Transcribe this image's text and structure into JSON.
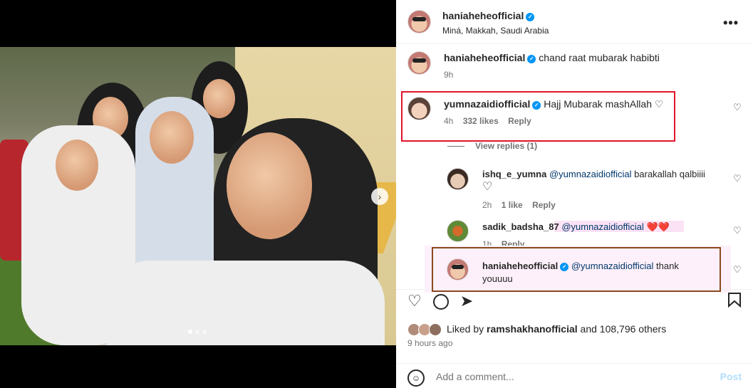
{
  "header": {
    "username": "haniaheheofficial",
    "location": "Miná, Makkah, Saudi Arabia",
    "more_icon": "more-horizontal-icon"
  },
  "caption": {
    "username": "haniaheheofficial",
    "text": "chand raat mubarak habibti",
    "time": "9h"
  },
  "comments": [
    {
      "username": "yumnazaidiofficial",
      "text": "Hajj Mubarak mashAllah ♡",
      "time": "4h",
      "likes": "332 likes",
      "reply": "Reply",
      "view_replies": "View replies (1)"
    }
  ],
  "replies": [
    {
      "username": "ishq_e_yumna",
      "mention": "@yumnazaidiofficial",
      "text": "barakallah qalbiiii",
      "text2": "♡",
      "time": "2h",
      "likes": "1 like",
      "reply": "Reply"
    },
    {
      "username": "sadik_badsha_87",
      "mention": "@yumnazaidiofficial",
      "text": "❤️❤️",
      "time": "1h",
      "reply": "Reply"
    },
    {
      "username": "haniaheheofficial",
      "mention": "@yumnazaidiofficial",
      "text": "thank",
      "text2": "youuuu"
    }
  ],
  "actions": {
    "like_icon": "heart-icon",
    "comment_icon": "comment-icon",
    "share_icon": "share-icon",
    "save_icon": "bookmark-icon"
  },
  "likes": {
    "liked_by_prefix": "Liked by",
    "liked_by_user": "ramshakhanofficial",
    "liked_by_rest": "and 108,796 others"
  },
  "posted_time": "9 hours ago",
  "add_comment": {
    "placeholder": "Add a comment...",
    "post_label": "Post"
  },
  "colors": {
    "highlight_red": "#e0152a",
    "highlight_brown": "#8b4a1e",
    "verified_blue": "#0095f6",
    "mention_blue": "#00376b",
    "post_disabled": "#b2dffc"
  }
}
